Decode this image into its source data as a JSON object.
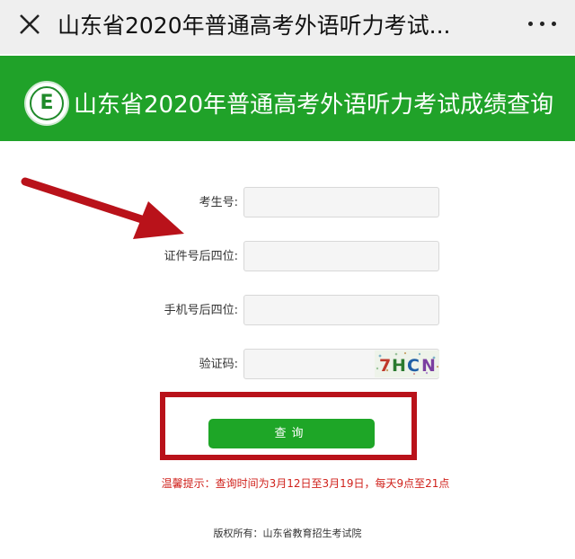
{
  "header": {
    "title": "山东省2020年普通高考外语听力考试...",
    "close_icon": "close-icon",
    "more_icon": "more-dots-icon"
  },
  "banner": {
    "title": "山东省2020年普通高考外语听力考试成绩查询",
    "logo_letter": "E",
    "background_color": "#20a229"
  },
  "form": {
    "exam_number_label": "考生号:",
    "exam_number_value": "",
    "id_last4_label": "证件号后四位:",
    "id_last4_value": "",
    "phone_last4_label": "手机号后四位:",
    "phone_last4_value": "",
    "captcha_label": "验证码:",
    "captcha_value": "",
    "captcha_text": "7HCN"
  },
  "query_button": {
    "label": "查询"
  },
  "notice": "温馨提示：查询时间为3月12日至3月19日，每天9点至21点",
  "footer": {
    "copyright": "版权所有：山东省教育招生考试院"
  },
  "colors": {
    "accent": "#20a229",
    "annotation_red": "#b9121a",
    "notice_red": "#d0221c"
  }
}
